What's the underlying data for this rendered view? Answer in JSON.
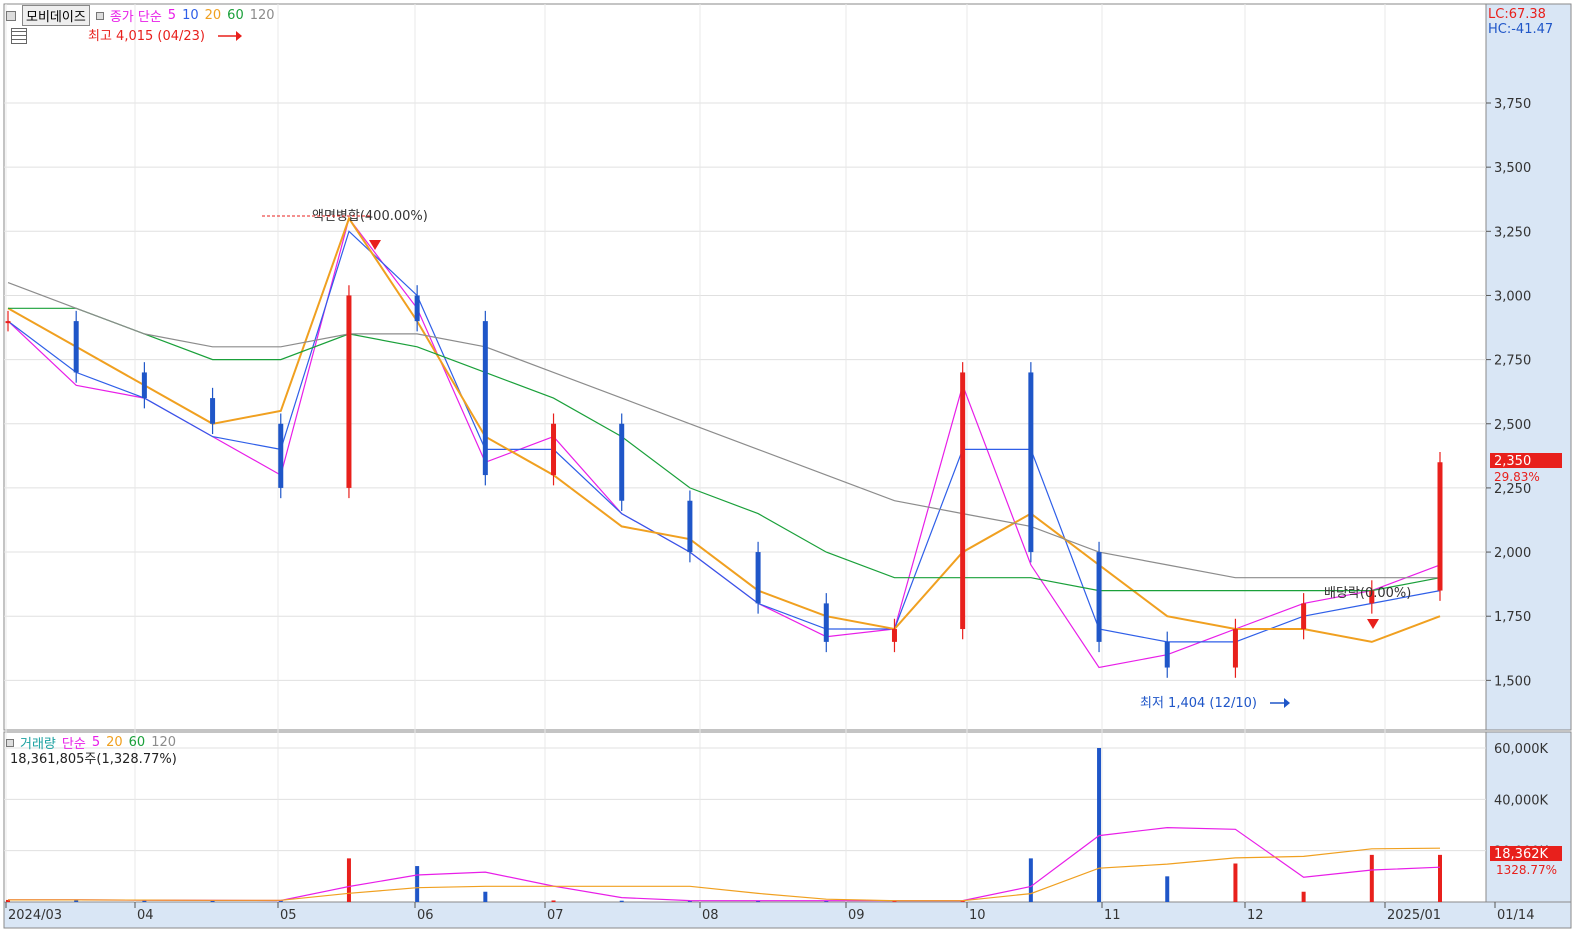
{
  "price_panel": {
    "symbol": "모비데이즈",
    "ma_label": "종가 단순",
    "ma_periods": [
      "5",
      "10",
      "20",
      "60",
      "120"
    ],
    "lc_label": "LC:67.38",
    "hc_label": "HC:-41.47",
    "high_annotation": "최고 4,015 (04/23)",
    "low_annotation": "최저 1,404 (12/10)",
    "split_annotation": "액면병합(400.00%)",
    "dividend_annotation": "배당락(0.00%)",
    "last_price": "2,350",
    "last_change": "29.83%",
    "y_ticks": [
      "3,750",
      "3,500",
      "3,250",
      "3,000",
      "2,750",
      "2,500",
      "2,250",
      "2,000",
      "1,750",
      "1,500"
    ]
  },
  "volume_panel": {
    "label": "거래량",
    "ma_label": "단순",
    "ma_periods": [
      "5",
      "20",
      "60",
      "120"
    ],
    "volume_text": "18,361,805주(1,328.77%)",
    "y_ticks": [
      "60,000K",
      "40,000K",
      "20,000K"
    ],
    "last_volume": "18,362K",
    "last_volume_pct": "1328.77%"
  },
  "x_axis": {
    "labels": [
      "2024/03",
      "04",
      "05",
      "06",
      "07",
      "08",
      "09",
      "10",
      "11",
      "12",
      "2025/01",
      "01/14"
    ]
  },
  "colors": {
    "up": "#e8201c",
    "down": "#1f56c8",
    "ma5": "#e81ee8",
    "ma10": "#2f5fe8",
    "ma20": "#f0a020",
    "ma60": "#1aa03a",
    "ma120": "#8c8c8c",
    "axis_bg": "#d9e6f5"
  },
  "chart_data": [
    {
      "type": "candlestick",
      "title": "",
      "ylim": [
        1404,
        4015
      ],
      "x": [
        "2024/03",
        "04",
        "05",
        "06",
        "07",
        "08",
        "09",
        "10",
        "11",
        "12",
        "2025/01",
        "01/14"
      ],
      "series": [
        {
          "name": "종가",
          "values": [
            2900,
            2700,
            2600,
            2500,
            2250,
            3000,
            2900,
            2300,
            2500,
            2200,
            2000,
            1800,
            1650,
            1700,
            2700,
            2000,
            1650,
            1550,
            1700,
            1800,
            1850,
            2350
          ]
        },
        {
          "name": "5",
          "values": [
            2900,
            2650,
            2600,
            2450,
            2300,
            3300,
            2950,
            2350,
            2450,
            2150,
            2000,
            1800,
            1670,
            1700,
            2650,
            1950,
            1550,
            1600,
            1700,
            1800,
            1850,
            1950
          ]
        },
        {
          "name": "10",
          "values": [
            2900,
            2700,
            2600,
            2450,
            2400,
            3250,
            3000,
            2400,
            2400,
            2150,
            2000,
            1800,
            1700,
            1700,
            2400,
            2400,
            1700,
            1650,
            1650,
            1750,
            1800,
            1850
          ]
        },
        {
          "name": "20",
          "values": [
            2950,
            2800,
            2650,
            2500,
            2550,
            3300,
            2900,
            2450,
            2300,
            2100,
            2050,
            1850,
            1750,
            1700,
            2000,
            2150,
            1950,
            1750,
            1700,
            1700,
            1650,
            1750
          ]
        },
        {
          "name": "60",
          "values": [
            2950,
            2950,
            2850,
            2750,
            2750,
            2850,
            2800,
            2700,
            2600,
            2450,
            2250,
            2150,
            2000,
            1900,
            1900,
            1900,
            1850,
            1850,
            1850,
            1850,
            1850,
            1900
          ]
        },
        {
          "name": "120",
          "values": [
            3050,
            2950,
            2850,
            2800,
            2800,
            2850,
            2850,
            2800,
            2700,
            2600,
            2500,
            2400,
            2300,
            2200,
            2150,
            2100,
            2000,
            1950,
            1900,
            1900,
            1900,
            1900
          ]
        }
      ]
    },
    {
      "type": "bar",
      "title": "",
      "ylim": [
        0,
        60000
      ],
      "x": [
        "2024/03",
        "04",
        "05",
        "06",
        "07",
        "08",
        "09",
        "10",
        "11",
        "12",
        "2025/01",
        "01/14"
      ],
      "series": [
        {
          "name": "거래량",
          "values": [
            800,
            800,
            600,
            500,
            600,
            17000,
            14000,
            4000,
            600,
            500,
            500,
            500,
            500,
            500,
            600,
            17000,
            60000,
            10000,
            15000,
            4000,
            18362,
            18362
          ]
        }
      ]
    }
  ]
}
